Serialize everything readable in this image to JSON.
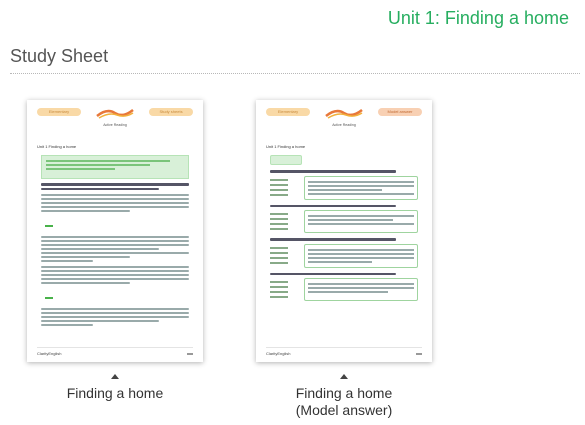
{
  "header": {
    "unit_title": "Unit 1: Finding a home",
    "section_title": "Study Sheet"
  },
  "cards": [
    {
      "caption": "Finding a home",
      "thumbnail": {
        "left_pill": "Elementary",
        "right_pill": "Study sheets",
        "logo_text": "Active Reading",
        "title": "Unit 1 Finding a home",
        "footer_brand": "ClarityEnglish"
      }
    },
    {
      "caption_line1": "Finding a home",
      "caption_line2": "(Model answer)",
      "thumbnail": {
        "left_pill": "Elementary",
        "right_pill": "Model answer",
        "logo_text": "Active Reading",
        "title": "Unit 1 Finding a home",
        "footer_brand": "ClarityEnglish"
      }
    }
  ],
  "colors": {
    "accent_green": "#27ae60",
    "logo_orange": "#e8783a"
  }
}
